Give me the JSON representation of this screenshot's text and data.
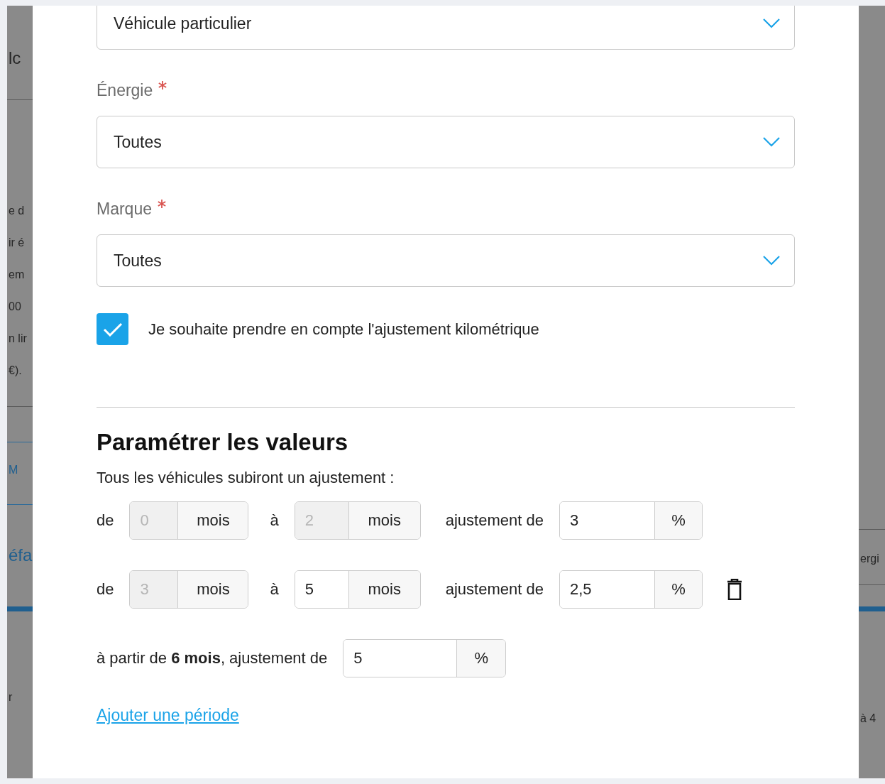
{
  "background": {
    "left_fragments": [
      {
        "text": "lc",
        "kind": "title"
      },
      {
        "text": "e d",
        "kind": "text"
      },
      {
        "text": "ir é",
        "kind": "text"
      },
      {
        "text": "em",
        "kind": "text"
      },
      {
        "text": "00",
        "kind": "text"
      },
      {
        "text": "n lir",
        "kind": "text"
      },
      {
        "text": "€).",
        "kind": "text"
      },
      {
        "text": "M",
        "kind": "tab"
      },
      {
        "text": "éfa",
        "kind": "heading"
      },
      {
        "text": "r",
        "kind": "text"
      }
    ],
    "right_fragments": [
      "ergi",
      "à 4"
    ]
  },
  "form": {
    "vehicle_type": {
      "value": "Véhicule particulier"
    },
    "fields": [
      {
        "label": "Énergie",
        "required": true,
        "value": "Toutes"
      },
      {
        "label": "Marque",
        "required": true,
        "value": "Toutes"
      }
    ],
    "mileage_adjustment": {
      "label": "Je souhaite prendre en compte l'ajustement kilométrique",
      "checked": true
    }
  },
  "values_section": {
    "title": "Paramétrer les valeurs",
    "subtitle": "Tous les véhicules subiront un ajustement :",
    "periods": [
      {
        "from_label": "de",
        "from": {
          "value": "0",
          "disabled": true,
          "unit": "mois"
        },
        "to_label": "à",
        "to": {
          "value": "2",
          "disabled": true,
          "unit": "mois"
        },
        "adjustment_label": "ajustement de",
        "adjustment": {
          "value": "3",
          "unit": "%"
        },
        "deletable": false
      },
      {
        "from_label": "de",
        "from": {
          "value": "3",
          "disabled": true,
          "unit": "mois"
        },
        "to_label": "à",
        "to": {
          "value": "5",
          "disabled": false,
          "unit": "mois"
        },
        "adjustment_label": "ajustement de",
        "adjustment": {
          "value": "2,5",
          "unit": "%"
        },
        "deletable": true
      }
    ],
    "final": {
      "label": "à partir de **6 mois**, ajustement de",
      "value": "5",
      "unit": "%"
    },
    "add_link": "Ajouter une période"
  }
}
